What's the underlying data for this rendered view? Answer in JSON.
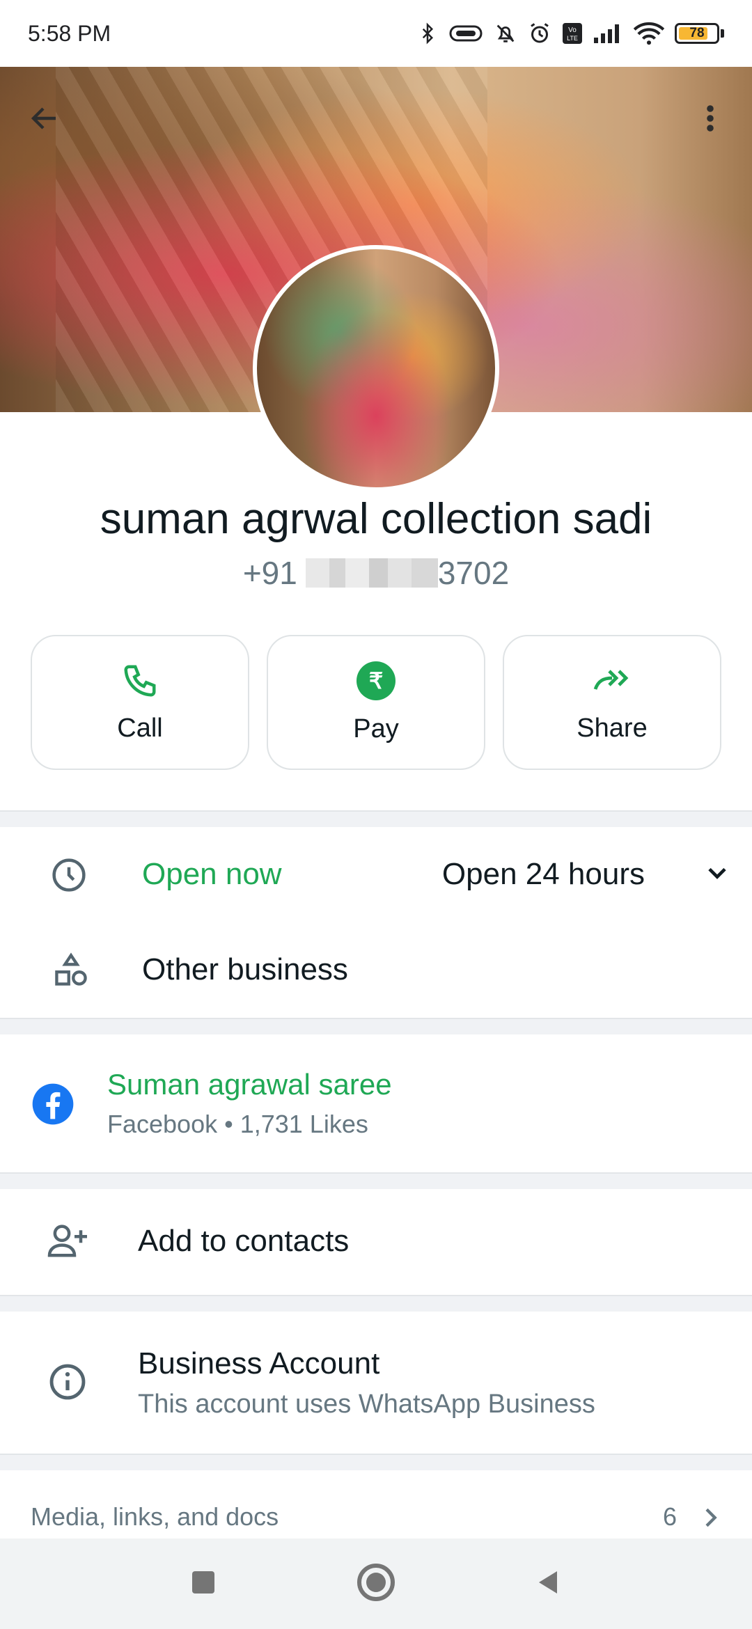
{
  "status_bar": {
    "time": "5:58 PM",
    "battery_level": "78",
    "icons": [
      "bluetooth-icon",
      "vibrate-icon",
      "mute-icon",
      "alarm-icon",
      "volte-icon",
      "signal-icon",
      "wifi-icon",
      "battery-icon"
    ]
  },
  "header": {
    "back_icon": "arrow-left-icon",
    "more_icon": "more-vert-icon"
  },
  "profile": {
    "name": "suman agrwal collection sadi",
    "phone_prefix": "+91",
    "phone_suffix": "3702"
  },
  "actions": [
    {
      "label": "Call",
      "icon": "phone-icon"
    },
    {
      "label": "Pay",
      "icon": "rupee-icon",
      "symbol": "₹"
    },
    {
      "label": "Share",
      "icon": "share-forward-icon"
    }
  ],
  "hours": {
    "status": "Open now",
    "value": "Open 24 hours"
  },
  "category": {
    "label": "Other business"
  },
  "facebook": {
    "title": "Suman agrawal saree",
    "subtitle": "Facebook • 1,731 Likes"
  },
  "add_contacts": {
    "label": "Add to contacts"
  },
  "business_account": {
    "title": "Business Account",
    "subtitle": "This account uses WhatsApp Business"
  },
  "media": {
    "label": "Media, links, and docs",
    "count": "6"
  },
  "colors": {
    "accent_green": "#1fa855",
    "text_primary": "#111b21",
    "text_secondary": "#667781",
    "facebook_blue": "#1877f2"
  }
}
